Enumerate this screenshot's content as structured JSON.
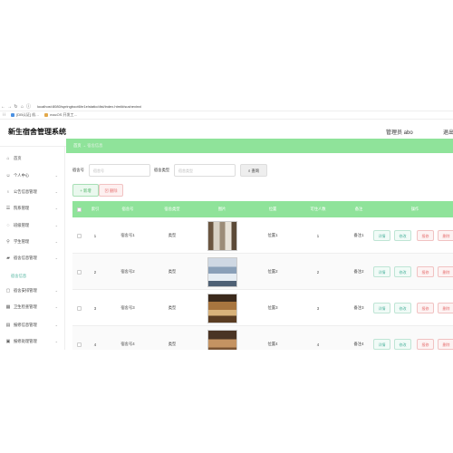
{
  "browser": {
    "url": "localhost:8080/springboot6hr1e/static/dist/index.html#/sushexinxi",
    "bookmarks": [
      "[DB认证] 机…",
      "macOS 开发工…"
    ]
  },
  "header": {
    "title": "新生宿舍管理系统",
    "user": "管理员 abo",
    "logout": "退出登录"
  },
  "sidebar": {
    "items": [
      {
        "icon": "home-icon",
        "glyph": "⌂",
        "label": "首页",
        "chevron": false
      },
      {
        "icon": "user-icon",
        "glyph": "☺",
        "label": "个人中心",
        "chevron": true
      },
      {
        "icon": "bulb-icon",
        "glyph": "♁",
        "label": "公告信息管理",
        "chevron": true
      },
      {
        "icon": "doc-icon",
        "glyph": "☰",
        "label": "院系管理",
        "chevron": true
      },
      {
        "icon": "chat-icon",
        "glyph": "◌",
        "label": "班级管理",
        "chevron": true
      },
      {
        "icon": "pin-icon",
        "glyph": "⚲",
        "label": "学生管理",
        "chevron": true
      },
      {
        "icon": "chat2-icon",
        "glyph": "▰",
        "label": "宿舍信息管理",
        "chevron": true
      },
      {
        "icon": "",
        "glyph": "",
        "label": "宿舍信息",
        "chevron": false,
        "sub": true
      },
      {
        "icon": "shield-icon",
        "glyph": "▢",
        "label": "宿舍安排管理",
        "chevron": true
      },
      {
        "icon": "grid-icon",
        "glyph": "▦",
        "label": "卫生检查管理",
        "chevron": true
      },
      {
        "icon": "list-icon",
        "glyph": "▤",
        "label": "报修信息管理",
        "chevron": true
      },
      {
        "icon": "box-icon",
        "glyph": "▣",
        "label": "报修处理管理",
        "chevron": true
      },
      {
        "icon": "msg-icon",
        "glyph": "▬",
        "label": "缴费信息管理",
        "chevron": true
      }
    ]
  },
  "breadcrumb": {
    "home": "首页",
    "sep": "→",
    "current": "宿舍信息"
  },
  "search": {
    "field1_label": "宿舍号",
    "field1_placeholder": "宿舍号",
    "field2_label": "宿舍类型",
    "field2_placeholder": "宿舍类型",
    "query_label": "查询",
    "query_icon": "⌕"
  },
  "toolbar": {
    "add_label": "+ 新增",
    "delete_label": "删除",
    "delete_icon": "⊠"
  },
  "table": {
    "headers": [
      "",
      "索引",
      "宿舍号",
      "宿舍类型",
      "图片",
      "位置",
      "可住人数",
      "备注",
      "操作"
    ],
    "rows": [
      {
        "index": "1",
        "room": "宿舍号1",
        "type": "类型",
        "location": "位置1",
        "capacity": "1",
        "note": "备注1"
      },
      {
        "index": "2",
        "room": "宿舍号2",
        "type": "类型",
        "location": "位置2",
        "capacity": "2",
        "note": "备注2"
      },
      {
        "index": "3",
        "room": "宿舍号3",
        "type": "类型",
        "location": "位置3",
        "capacity": "3",
        "note": "备注3"
      },
      {
        "index": "4",
        "room": "宿舍号4",
        "type": "类型",
        "location": "位置4",
        "capacity": "4",
        "note": "备注4"
      }
    ],
    "actions": {
      "detail": "详情",
      "edit": "修改",
      "repair": "报修",
      "delete": "删除"
    }
  },
  "colors": {
    "accent": "#8fe39a",
    "teal": "#52b5a0",
    "danger": "#e67070"
  }
}
